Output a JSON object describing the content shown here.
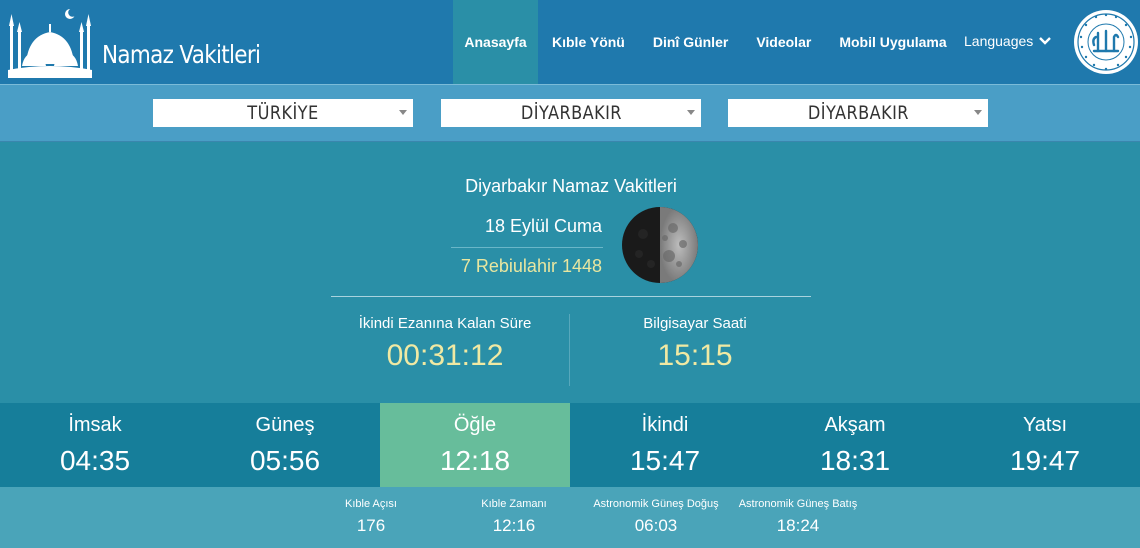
{
  "header": {
    "brand": "Namaz Vakitleri",
    "nav": [
      "Anasayfa",
      "Kıble Yönü",
      "Dinî Günler",
      "Videolar",
      "Mobil Uygulama"
    ],
    "active_nav_index": 0,
    "languages_label": "Languages"
  },
  "selectors": {
    "country": "TÜRKİYE",
    "province": "DİYARBAKIR",
    "district": "DİYARBAKIR"
  },
  "today": {
    "city_title": "Diyarbakır Namaz Vakitleri",
    "gregorian_date": "18 Eylül Cuma",
    "hijri_date": "7 Rebiulahir 1448"
  },
  "countdown": {
    "label": "İkindi Ezanına Kalan Süre",
    "value": "00:31:12"
  },
  "clock": {
    "label": "Bilgisayar Saati",
    "value": "15:15"
  },
  "prayers": [
    {
      "name": "İmsak",
      "time": "04:35"
    },
    {
      "name": "Güneş",
      "time": "05:56"
    },
    {
      "name": "Öğle",
      "time": "12:18"
    },
    {
      "name": "İkindi",
      "time": "15:47"
    },
    {
      "name": "Akşam",
      "time": "18:31"
    },
    {
      "name": "Yatsı",
      "time": "19:47"
    }
  ],
  "active_prayer_index": 2,
  "extra_info": [
    {
      "label": "Kıble Açısı",
      "value": "176"
    },
    {
      "label": "Kıble Zamanı",
      "value": "12:16"
    },
    {
      "label": "Astronomik Güneş Doğuş",
      "value": "06:03"
    },
    {
      "label": "Astronomik Güneş Batış",
      "value": "18:24"
    }
  ],
  "colors": {
    "header_bg": "#1f79ad",
    "main_bg": "#2a8fa7",
    "active_prayer_bg": "#67bd9b",
    "highlight_text": "#f0e9a3"
  }
}
